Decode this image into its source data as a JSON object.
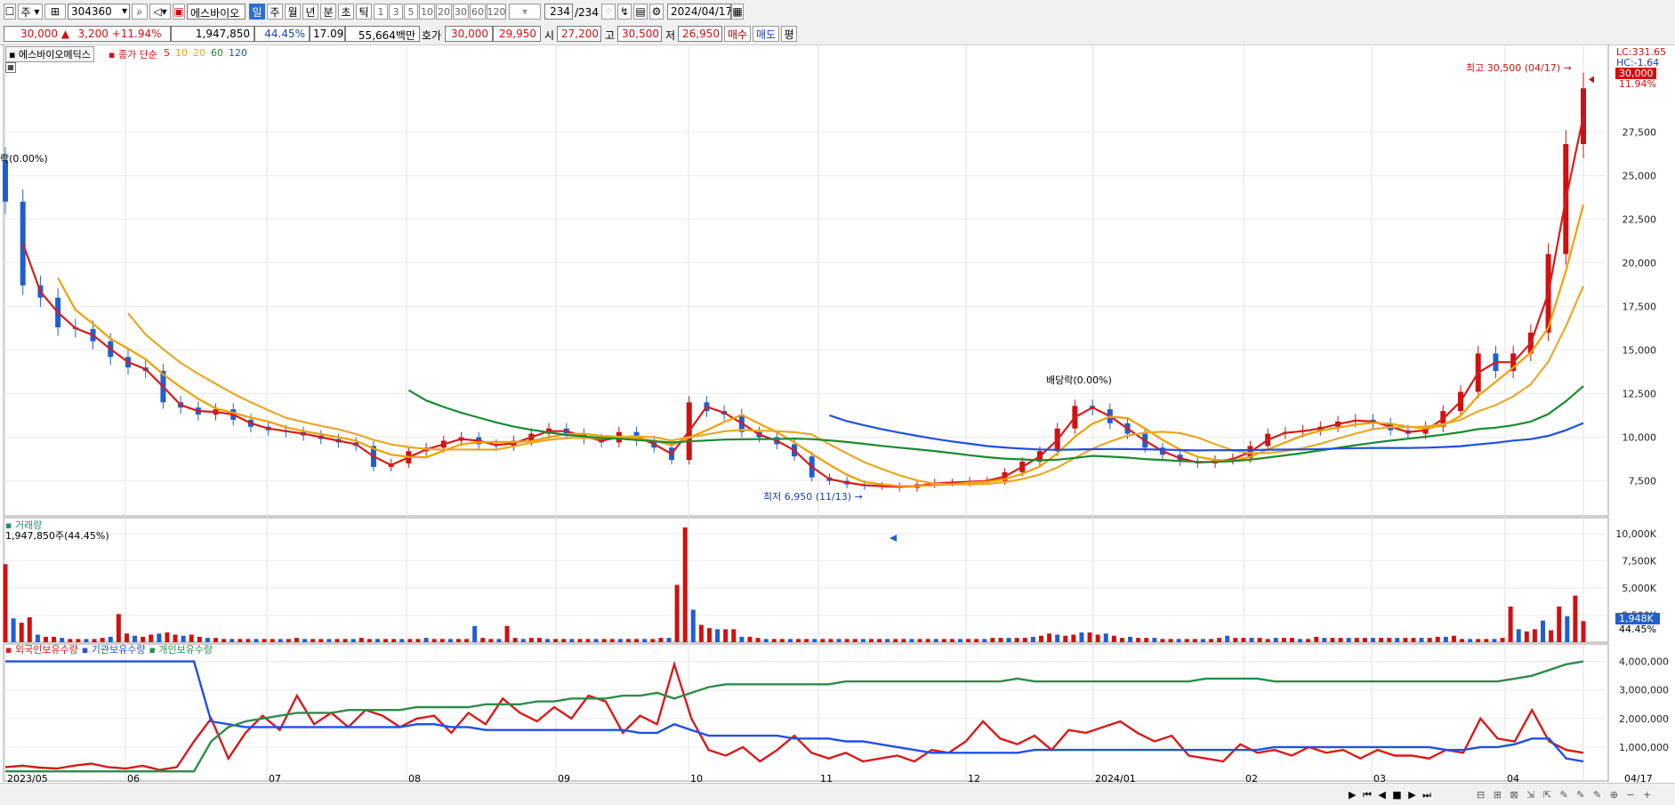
{
  "toolbar": {
    "period_label": "주",
    "code": "304360",
    "stock_name": "에스바이오",
    "periods": [
      "일",
      "주",
      "월",
      "년",
      "분",
      "초",
      "틱"
    ],
    "active_period": "일",
    "intervals": [
      "1",
      "3",
      "5",
      "10",
      "20",
      "30",
      "60",
      "120"
    ],
    "count_current": "234",
    "count_total": "/234",
    "date": "2024/04/17"
  },
  "quote": {
    "price": "30,000",
    "change_arrow": "▲",
    "change": "3,200",
    "change_pct": "+11.94%",
    "volume": "1,947,850",
    "volume_ratio": "44.45%",
    "turnover": "17.09%",
    "amount": "55,664백만",
    "hoga_label": "호가",
    "ask": "30,000",
    "bid": "29,950",
    "open_label": "시",
    "open": "27,200",
    "high_label": "고",
    "high": "30,500",
    "low_label": "저",
    "low": "26,950",
    "buy_label": "매수",
    "sell_label": "매도",
    "eval_label": "평"
  },
  "price_panel": {
    "stock_label": "에스바이오메딕스",
    "ma_label": "종가 단순",
    "ma_periods": [
      "5",
      "10",
      "20",
      "60",
      "120"
    ],
    "lc_label": "LC:331.65",
    "hc_label": "HC:-1.64",
    "last_price_tag": "30,000",
    "last_pct_tag": "11.94%",
    "high_annotation": "최고 30,500 (04/17) →",
    "low_annotation": "최저 6,950 (11/13) →",
    "dividend_annotation": "배당락(0.00%)",
    "left_annotation": "락(0.00%)"
  },
  "volume_panel": {
    "title": "거래량",
    "value_label": "1,947,850주(44.45%)",
    "last_tag": "1,948K",
    "last_pct": "44.45%"
  },
  "holding_panel": {
    "series_labels": [
      "외국인보유수량",
      "기관보유수량",
      "개인보유수량"
    ]
  },
  "x_axis_labels": [
    "2023/05",
    "06",
    "07",
    "08",
    "09",
    "10",
    "11",
    "12",
    "2024/01",
    "02",
    "03",
    "04",
    "04/17"
  ],
  "colors": {
    "up": "#d01010",
    "down": "#1f5fd0",
    "ma5": "#d81b1b",
    "ma10": "#f0a000",
    "ma20": "#e8a82a",
    "ma60": "#1a8a30",
    "ma120": "#2050e0",
    "foreign": "#d81b1b",
    "institution": "#2050e0",
    "individual": "#2e8b4a"
  },
  "chart_data": [
    {
      "type": "candlestick",
      "title": "에스바이오메딕스",
      "y_ticks": [
        7500,
        10000,
        12500,
        15000,
        17500,
        20000,
        22500,
        25000,
        27500
      ],
      "ylim": [
        6000,
        32000
      ],
      "x_month_labels": [
        "2023/05",
        "06",
        "07",
        "08",
        "09",
        "10",
        "11",
        "12",
        "2024/01",
        "02",
        "03",
        "04"
      ],
      "close_weekly": [
        23500,
        18700,
        18000,
        16300,
        16200,
        15500,
        14600,
        14000,
        13800,
        12000,
        11700,
        11300,
        11600,
        11000,
        10600,
        10400,
        10300,
        10100,
        9900,
        9700,
        9500,
        8300,
        8500,
        9200,
        9400,
        9800,
        10000,
        9600,
        9500,
        9800,
        10200,
        10500,
        10200,
        9900,
        9700,
        10300,
        9800,
        9400,
        8700,
        12000,
        11500,
        11300,
        10300,
        10000,
        9600,
        8900,
        7700,
        7500,
        7300,
        7200,
        7200,
        7100,
        7300,
        7400,
        7400,
        7500,
        7500,
        8000,
        8600,
        9200,
        10500,
        11800,
        11600,
        10800,
        10200,
        9400,
        9000,
        8600,
        8500,
        8700,
        8800,
        9500,
        10200,
        10300,
        10400,
        10600,
        10900,
        11000,
        10800,
        10400,
        10200,
        10600,
        11500,
        12600,
        14800,
        13800,
        14800,
        16000,
        20500,
        26800,
        30000
      ],
      "high": 30500,
      "high_date": "04/17",
      "low": 6950,
      "low_date": "11/13",
      "last_close": 30000,
      "ma_periods": [
        5,
        10,
        20,
        60,
        120
      ]
    },
    {
      "type": "bar",
      "title": "거래량",
      "y_ticks": [
        "2,500K",
        "5,000K",
        "7,500K",
        "10,000K"
      ],
      "ylim": [
        0,
        11000
      ],
      "units": "K",
      "values": [
        7200,
        2200,
        1800,
        2300,
        700,
        500,
        500,
        400,
        300,
        300,
        300,
        300,
        400,
        500,
        2600,
        800,
        600,
        500,
        700,
        800,
        900,
        700,
        600,
        700,
        500,
        400,
        400,
        300,
        300,
        300,
        300,
        300,
        300,
        300,
        300,
        300,
        400,
        300,
        300,
        300,
        300,
        300,
        300,
        300,
        400,
        300,
        300,
        300,
        300,
        300,
        300,
        300,
        400,
        300,
        300,
        300,
        300,
        300,
        1500,
        400,
        300,
        300,
        1500,
        400,
        300,
        400,
        400,
        300,
        300,
        300,
        300,
        300,
        300,
        300,
        300,
        300,
        300,
        300,
        300,
        300,
        300,
        400,
        400,
        5300,
        10600,
        3000,
        1600,
        1300,
        1200,
        1200,
        1200,
        500,
        500,
        400,
        300,
        300,
        300,
        300,
        300,
        300,
        300,
        300,
        300,
        300,
        300,
        300,
        300,
        300,
        300,
        300,
        300,
        300,
        300,
        300,
        300,
        300,
        300,
        300,
        300,
        300,
        300,
        300,
        400,
        400,
        400,
        400,
        400,
        500,
        600,
        800,
        700,
        600,
        700,
        900,
        900,
        700,
        800,
        600,
        400,
        500,
        400,
        400,
        400,
        300,
        300,
        300,
        300,
        300,
        300,
        300,
        400,
        600,
        400,
        400,
        400,
        400,
        300,
        400,
        400,
        400,
        300,
        300,
        500,
        400,
        400,
        400,
        400,
        400,
        400,
        400,
        400,
        400,
        400,
        400,
        400,
        400,
        400,
        500,
        500,
        600,
        300,
        300,
        300,
        300,
        300,
        400,
        3300,
        1200,
        1000,
        1200,
        2000,
        1100,
        3300,
        2400,
        4300,
        1948
      ],
      "last": 1948
    },
    {
      "type": "line",
      "title": "보유수량",
      "y_ticks": [
        "1,000,000",
        "2,000,000",
        "3,000,000",
        "4,000,000"
      ],
      "ylim": [
        0,
        4300000
      ],
      "series": [
        {
          "name": "외국인보유수량",
          "values": [
            300000,
            350000,
            280000,
            250000,
            350000,
            420000,
            300000,
            250000,
            350000,
            200000,
            300000,
            1200000,
            2000000,
            600000,
            1500000,
            2100000,
            1600000,
            2800000,
            1800000,
            2200000,
            1700000,
            2300000,
            2100000,
            1700000,
            2000000,
            2100000,
            1500000,
            2200000,
            1800000,
            2700000,
            2200000,
            1900000,
            2400000,
            2000000,
            2800000,
            2600000,
            1500000,
            2100000,
            1800000,
            3900000,
            2000000,
            900000,
            700000,
            1000000,
            500000,
            900000,
            1400000,
            800000,
            600000,
            800000,
            500000,
            600000,
            700000,
            500000,
            900000,
            800000,
            1200000,
            1900000,
            1300000,
            1100000,
            1400000,
            900000,
            1600000,
            1500000,
            1700000,
            1900000,
            1500000,
            1200000,
            1400000,
            700000,
            600000,
            500000,
            1100000,
            800000,
            900000,
            700000,
            1000000,
            800000,
            900000,
            600000,
            900000,
            700000,
            700000,
            600000,
            900000,
            800000,
            2000000,
            1300000,
            1200000,
            2300000,
            1200000,
            900000,
            800000
          ]
        },
        {
          "name": "기관보유수량",
          "values": [
            4000000,
            4000000,
            4000000,
            4000000,
            4000000,
            4000000,
            4000000,
            4000000,
            4000000,
            4000000,
            4000000,
            4000000,
            1900000,
            1800000,
            1700000,
            1700000,
            1700000,
            1700000,
            1700000,
            1700000,
            1700000,
            1700000,
            1700000,
            1700000,
            1800000,
            1800000,
            1700000,
            1700000,
            1600000,
            1600000,
            1600000,
            1600000,
            1600000,
            1600000,
            1600000,
            1600000,
            1600000,
            1500000,
            1500000,
            1800000,
            1600000,
            1400000,
            1400000,
            1400000,
            1400000,
            1400000,
            1300000,
            1300000,
            1300000,
            1200000,
            1200000,
            1100000,
            1000000,
            900000,
            800000,
            800000,
            800000,
            800000,
            800000,
            800000,
            900000,
            900000,
            900000,
            900000,
            900000,
            900000,
            900000,
            900000,
            900000,
            900000,
            900000,
            900000,
            900000,
            900000,
            1000000,
            1000000,
            1000000,
            1000000,
            1000000,
            1000000,
            1000000,
            1000000,
            1000000,
            1000000,
            900000,
            900000,
            1000000,
            1000000,
            1100000,
            1300000,
            1300000,
            600000,
            500000
          ]
        },
        {
          "name": "개인보유수량",
          "values": [
            150000,
            150000,
            150000,
            150000,
            150000,
            150000,
            150000,
            150000,
            150000,
            150000,
            150000,
            150000,
            1200000,
            1700000,
            1900000,
            2000000,
            2100000,
            2200000,
            2200000,
            2200000,
            2300000,
            2300000,
            2300000,
            2300000,
            2400000,
            2400000,
            2400000,
            2400000,
            2500000,
            2500000,
            2500000,
            2600000,
            2600000,
            2700000,
            2700000,
            2700000,
            2800000,
            2800000,
            2900000,
            2700000,
            2900000,
            3100000,
            3200000,
            3200000,
            3200000,
            3200000,
            3200000,
            3200000,
            3200000,
            3300000,
            3300000,
            3300000,
            3300000,
            3300000,
            3300000,
            3300000,
            3300000,
            3300000,
            3300000,
            3400000,
            3300000,
            3300000,
            3300000,
            3300000,
            3300000,
            3300000,
            3300000,
            3300000,
            3300000,
            3300000,
            3400000,
            3400000,
            3400000,
            3400000,
            3300000,
            3300000,
            3300000,
            3300000,
            3300000,
            3300000,
            3300000,
            3300000,
            3300000,
            3300000,
            3300000,
            3300000,
            3300000,
            3300000,
            3400000,
            3500000,
            3700000,
            3900000,
            4000000
          ]
        }
      ]
    }
  ]
}
